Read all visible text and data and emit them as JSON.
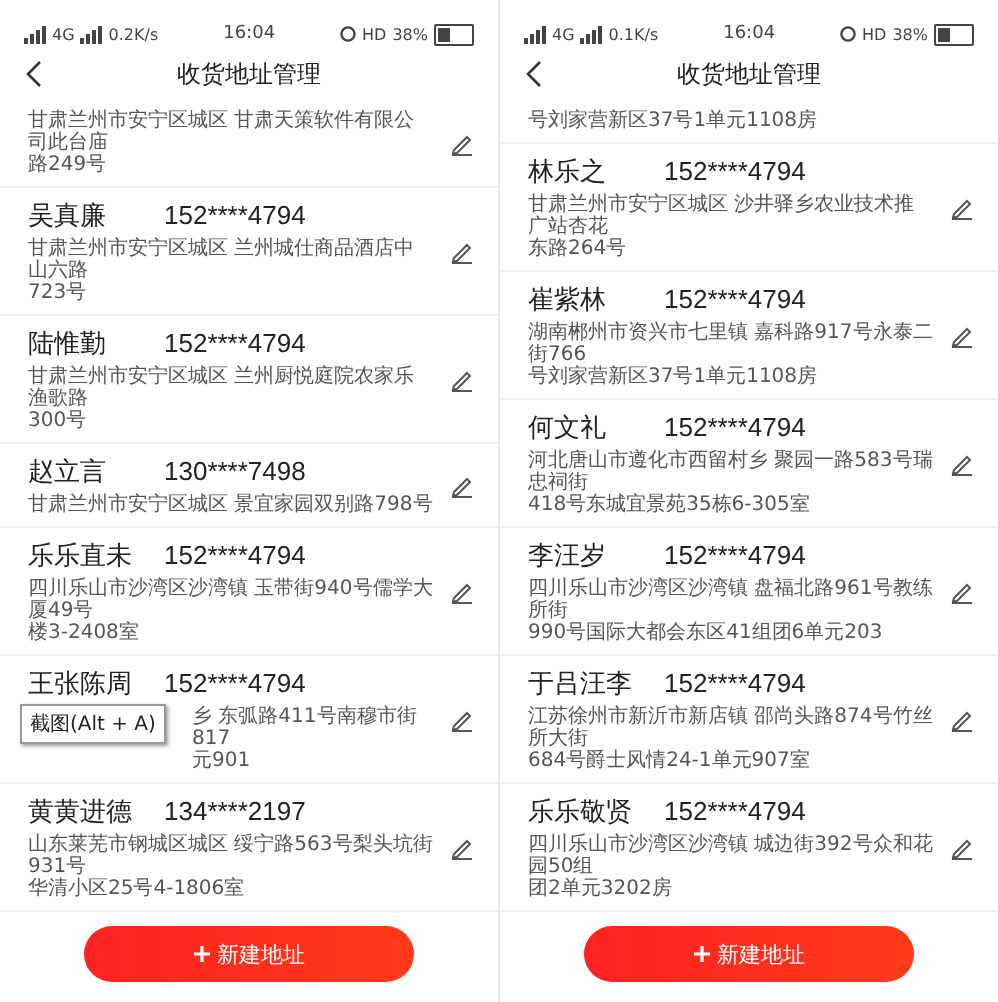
{
  "screens": [
    {
      "status_bar": {
        "network": "4G",
        "speed": "0.2K/s",
        "time": "16:04",
        "hd": "HD",
        "battery": "38%"
      },
      "header": {
        "title": "收货地址管理"
      },
      "addresses": [
        {
          "kind": "partial",
          "edit_icon": true,
          "address": [
            "甘肃兰州市安宁区城区 甘肃天策软件有限公司此台庙",
            "路249号"
          ]
        },
        {
          "kind": "full",
          "name": "吴真廉",
          "phone": "152****4794",
          "address": [
            "甘肃兰州市安宁区城区 兰州城仕商品酒店中山六路",
            "723号"
          ]
        },
        {
          "kind": "full",
          "name": "陆惟勤",
          "phone": "152****4794",
          "address": [
            "甘肃兰州市安宁区城区 兰州厨悦庭院农家乐渔歌路",
            "300号"
          ]
        },
        {
          "kind": "full",
          "name": "赵立言",
          "phone": "130****7498",
          "address": [
            "甘肃兰州市安宁区城区 景宜家园双别路798号"
          ]
        },
        {
          "kind": "full",
          "name": "乐乐直未",
          "phone": "152****4794",
          "address": [
            "四川乐山市沙湾区沙湾镇 玉带街940号儒学大厦49号",
            "楼3-2408室"
          ]
        },
        {
          "kind": "full",
          "name": "王张陈周",
          "phone": "152****4794",
          "tooltip": "截图(Alt + A)",
          "address": [
            "乡 东弧路411号南穆市街817",
            "元901"
          ]
        },
        {
          "kind": "full",
          "name": "黄黄进德",
          "phone": "134****2197",
          "address": [
            "山东莱芜市钢城区城区 绥宁路563号梨头坑街931号",
            "华清小区25号4-1806室"
          ]
        }
      ],
      "add_button": "新建地址"
    },
    {
      "status_bar": {
        "network": "4G",
        "speed": "0.1K/s",
        "time": "16:04",
        "hd": "HD",
        "battery": "38%"
      },
      "header": {
        "title": "收货地址管理"
      },
      "addresses": [
        {
          "kind": "partial",
          "edit_icon": false,
          "address": [
            "号刘家营新区37号1单元1108房"
          ]
        },
        {
          "kind": "full",
          "name": "林乐之",
          "phone": "152****4794",
          "address": [
            "甘肃兰州市安宁区城区 沙井驿乡农业技术推广站杏花",
            "东路264号"
          ]
        },
        {
          "kind": "full",
          "name": "崔紫林",
          "phone": "152****4794",
          "address": [
            "湖南郴州市资兴市七里镇 嘉科路917号永泰二街766",
            "号刘家营新区37号1单元1108房"
          ]
        },
        {
          "kind": "full",
          "name": "何文礼",
          "phone": "152****4794",
          "address": [
            "河北唐山市遵化市西留村乡 聚园一路583号瑞忠祠街",
            "418号东城宜景苑35栋6-305室"
          ]
        },
        {
          "kind": "full",
          "name": "李汪岁",
          "phone": "152****4794",
          "address": [
            "四川乐山市沙湾区沙湾镇 盘福北路961号教练所街",
            "990号国际大都会东区41组团6单元203"
          ]
        },
        {
          "kind": "full",
          "name": "于吕汪李",
          "phone": "152****4794",
          "address": [
            "江苏徐州市新沂市新店镇 邵尚头路874号竹丝所大街",
            "684号爵士风情24-1单元907室"
          ]
        },
        {
          "kind": "full",
          "name": "乐乐敬贤",
          "phone": "152****4794",
          "address": [
            "四川乐山市沙湾区沙湾镇 城边街392号众和花园50组",
            "团2单元3202房"
          ]
        }
      ],
      "add_button": "新建地址"
    }
  ]
}
